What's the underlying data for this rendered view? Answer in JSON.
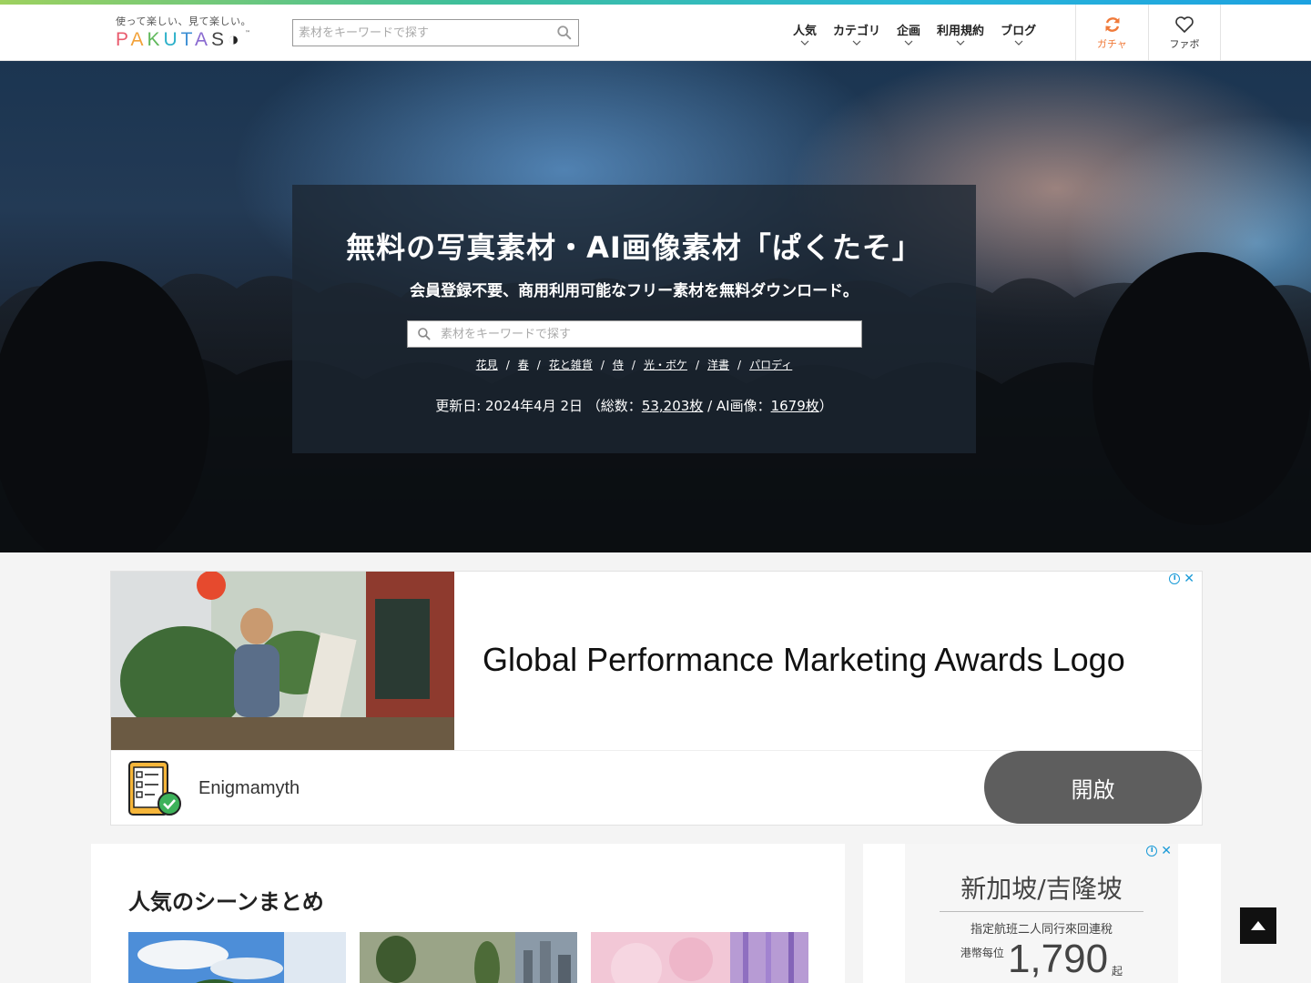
{
  "header": {
    "logo_tagline": "使って楽しい、見て楽しい。",
    "logo_wordmark": [
      "P",
      "A",
      "K",
      "U",
      "T",
      "A",
      "S"
    ],
    "logo_tm": "™",
    "search_placeholder": "素材をキーワードで探す",
    "nav": [
      {
        "label": "人気"
      },
      {
        "label": "カテゴリ"
      },
      {
        "label": "企画"
      },
      {
        "label": "利用規約"
      },
      {
        "label": "ブログ"
      }
    ],
    "gacha_label": "ガチャ",
    "fav_label": "ファボ"
  },
  "hero": {
    "title": "無料の写真素材・AI画像素材「ぱくたそ」",
    "subtitle": "会員登録不要、商用利用可能なフリー素材を無料ダウンロード。",
    "search_placeholder": "素材をキーワードで探す",
    "tags": [
      "花見",
      "春",
      "花と雑貨",
      "侍",
      "光・ボケ",
      "洋書",
      "パロディ"
    ],
    "tag_separator": "/",
    "update_prefix": "更新日: 2024年4月 2日 （総数：",
    "total_count": "53,203枚",
    "ai_prefix": " / AI画像：",
    "ai_count": "1679枚",
    "update_suffix": "）"
  },
  "ad_banner": {
    "headline": "Global Performance Marketing Awards Logo",
    "brand": "Enigmamyth",
    "open_label": "開啟",
    "info_icon": "ⓘ",
    "close_icon": "✕"
  },
  "main": {
    "section_title": "人気のシーンまとめ"
  },
  "side_ad": {
    "title": "新加坡/吉隆坡",
    "subtitle": "指定航班二人同行來回連稅",
    "price_prefix": "港幣每位",
    "price": "1,790",
    "price_suffix": "起",
    "info_icon": "ⓘ",
    "close_icon": "✕"
  },
  "colors": {
    "gacha_accent": "#f07a3a",
    "ad_info_blue": "#1a9ad7",
    "open_button": "#5e5e5e"
  },
  "icons": {
    "search": "search-icon",
    "chevron": "chevron-down-icon",
    "gacha": "refresh-icon",
    "fav": "heart-icon",
    "to_top": "arrow-up-icon"
  }
}
